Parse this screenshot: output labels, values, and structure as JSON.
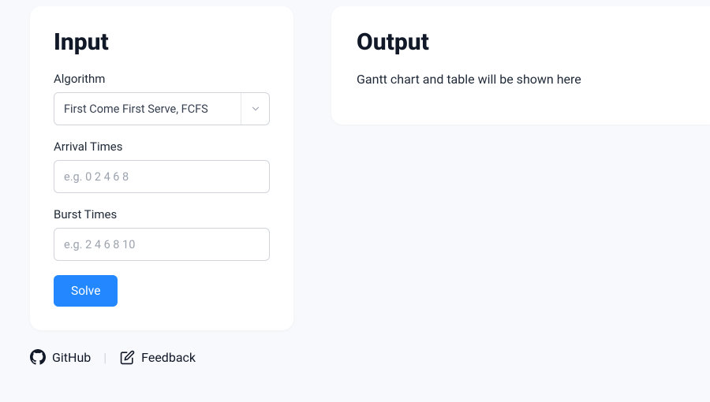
{
  "input": {
    "title": "Input",
    "algorithm": {
      "label": "Algorithm",
      "selected": "First Come First Serve, FCFS"
    },
    "arrival": {
      "label": "Arrival Times",
      "placeholder": "e.g. 0 2 4 6 8",
      "value": ""
    },
    "burst": {
      "label": "Burst Times",
      "placeholder": "e.g. 2 4 6 8 10",
      "value": ""
    },
    "solve_label": "Solve"
  },
  "output": {
    "title": "Output",
    "placeholder_text": "Gantt chart and table will be shown here"
  },
  "footer": {
    "github_label": "GitHub",
    "feedback_label": "Feedback"
  }
}
